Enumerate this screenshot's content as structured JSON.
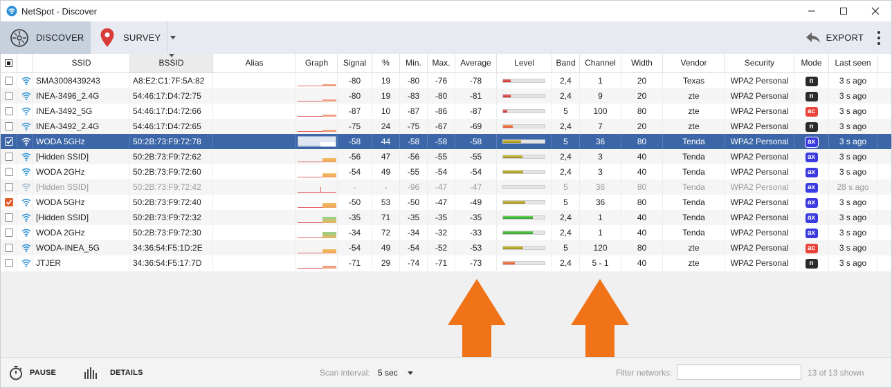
{
  "window": {
    "title": "NetSpot - Discover"
  },
  "toolbar": {
    "discover_label": "DISCOVER",
    "survey_label": "SURVEY",
    "export_label": "EXPORT"
  },
  "columns": [
    "SSID",
    "BSSID",
    "Alias",
    "Graph",
    "Signal",
    "%",
    "Min.",
    "Max.",
    "Average",
    "Level",
    "Band",
    "Channel",
    "Width",
    "Vendor",
    "Security",
    "Mode",
    "Last seen"
  ],
  "rows": [
    {
      "checked": false,
      "ssid": "SMA3008439243",
      "bssid": "A8:E2:C1:7F:5A:82",
      "alias": "",
      "signal": "-80",
      "pct": "19",
      "min": "-80",
      "max": "-76",
      "avg": "-78",
      "level": 0.19,
      "band": "2,4",
      "channel": "1",
      "width": "20",
      "vendor": "Texas",
      "security": "WPA2 Personal",
      "mode": "n",
      "last_seen": "3 s ago",
      "state": "normal"
    },
    {
      "checked": false,
      "ssid": "INEA-3496_2.4G",
      "bssid": "54:46:17:D4:72:75",
      "alias": "",
      "signal": "-80",
      "pct": "19",
      "min": "-83",
      "max": "-80",
      "avg": "-81",
      "level": 0.19,
      "band": "2,4",
      "channel": "9",
      "width": "20",
      "vendor": "zte",
      "security": "WPA2 Personal",
      "mode": "n",
      "last_seen": "3 s ago",
      "state": "normal"
    },
    {
      "checked": false,
      "ssid": "INEA-3492_5G",
      "bssid": "54:46:17:D4:72:66",
      "alias": "",
      "signal": "-87",
      "pct": "10",
      "min": "-87",
      "max": "-86",
      "avg": "-87",
      "level": 0.1,
      "band": "5",
      "channel": "100",
      "width": "80",
      "vendor": "zte",
      "security": "WPA2 Personal",
      "mode": "ac",
      "last_seen": "3 s ago",
      "state": "normal"
    },
    {
      "checked": false,
      "ssid": "INEA-3492_2.4G",
      "bssid": "54:46:17:D4:72:65",
      "alias": "",
      "signal": "-75",
      "pct": "24",
      "min": "-75",
      "max": "-67",
      "avg": "-69",
      "level": 0.24,
      "band": "2,4",
      "channel": "7",
      "width": "20",
      "vendor": "zte",
      "security": "WPA2 Personal",
      "mode": "n",
      "last_seen": "3 s ago",
      "state": "normal"
    },
    {
      "checked": true,
      "ssid": "WODA 5GHz",
      "bssid": "50:2B:73:F9:72:78",
      "alias": "",
      "signal": "-58",
      "pct": "44",
      "min": "-58",
      "max": "-58",
      "avg": "-58",
      "level": 0.44,
      "band": "5",
      "channel": "36",
      "width": "80",
      "vendor": "Tenda",
      "security": "WPA2 Personal",
      "mode": "ax",
      "last_seen": "3 s ago",
      "state": "selected"
    },
    {
      "checked": false,
      "ssid": "[Hidden SSID]",
      "bssid": "50:2B:73:F9:72:62",
      "alias": "",
      "signal": "-56",
      "pct": "47",
      "min": "-56",
      "max": "-55",
      "avg": "-55",
      "level": 0.47,
      "band": "2,4",
      "channel": "3",
      "width": "40",
      "vendor": "Tenda",
      "security": "WPA2 Personal",
      "mode": "ax",
      "last_seen": "3 s ago",
      "state": "normal"
    },
    {
      "checked": false,
      "ssid": "WODA 2GHz",
      "bssid": "50:2B:73:F9:72:60",
      "alias": "",
      "signal": "-54",
      "pct": "49",
      "min": "-55",
      "max": "-54",
      "avg": "-54",
      "level": 0.49,
      "band": "2,4",
      "channel": "3",
      "width": "40",
      "vendor": "Tenda",
      "security": "WPA2 Personal",
      "mode": "ax",
      "last_seen": "3 s ago",
      "state": "normal"
    },
    {
      "checked": false,
      "ssid": "[Hidden SSID]",
      "bssid": "50:2B:73:F9:72:42",
      "alias": "",
      "signal": "-",
      "pct": "-",
      "min": "-96",
      "max": "-47",
      "avg": "-47",
      "level": 0,
      "band": "5",
      "channel": "36",
      "width": "80",
      "vendor": "Tenda",
      "security": "WPA2 Personal",
      "mode": "ax",
      "last_seen": "28 s ago",
      "state": "stale"
    },
    {
      "checked": true,
      "ssid": "WODA 5GHz",
      "bssid": "50:2B:73:F9:72:40",
      "alias": "",
      "signal": "-50",
      "pct": "53",
      "min": "-50",
      "max": "-47",
      "avg": "-49",
      "level": 0.53,
      "band": "5",
      "channel": "36",
      "width": "80",
      "vendor": "Tenda",
      "security": "WPA2 Personal",
      "mode": "ax",
      "last_seen": "3 s ago",
      "state": "normal"
    },
    {
      "checked": false,
      "ssid": "[Hidden SSID]",
      "bssid": "50:2B:73:F9:72:32",
      "alias": "",
      "signal": "-35",
      "pct": "71",
      "min": "-35",
      "max": "-35",
      "avg": "-35",
      "level": 0.71,
      "band": "2,4",
      "channel": "1",
      "width": "40",
      "vendor": "Tenda",
      "security": "WPA2 Personal",
      "mode": "ax",
      "last_seen": "3 s ago",
      "state": "normal"
    },
    {
      "checked": false,
      "ssid": "WODA 2GHz",
      "bssid": "50:2B:73:F9:72:30",
      "alias": "",
      "signal": "-34",
      "pct": "72",
      "min": "-34",
      "max": "-32",
      "avg": "-33",
      "level": 0.72,
      "band": "2,4",
      "channel": "1",
      "width": "40",
      "vendor": "Tenda",
      "security": "WPA2 Personal",
      "mode": "ax",
      "last_seen": "3 s ago",
      "state": "normal"
    },
    {
      "checked": false,
      "ssid": "WODA-INEA_5G",
      "bssid": "34:36:54:F5:1D:2E",
      "alias": "",
      "signal": "-54",
      "pct": "49",
      "min": "-54",
      "max": "-52",
      "avg": "-53",
      "level": 0.49,
      "band": "5",
      "channel": "120",
      "width": "80",
      "vendor": "zte",
      "security": "WPA2 Personal",
      "mode": "ac",
      "last_seen": "3 s ago",
      "state": "normal"
    },
    {
      "checked": false,
      "ssid": "JTJER",
      "bssid": "34:36:54:F5:17:7D",
      "alias": "",
      "signal": "-71",
      "pct": "29",
      "min": "-74",
      "max": "-71",
      "avg": "-73",
      "level": 0.29,
      "band": "2,4",
      "channel": "5 - 1",
      "width": "40",
      "vendor": "zte",
      "security": "WPA2 Personal",
      "mode": "n",
      "last_seen": "3 s ago",
      "state": "normal"
    }
  ],
  "footer": {
    "pause_label": "PAUSE",
    "details_label": "DETAILS",
    "scan_interval_label": "Scan interval:",
    "scan_interval_value": "5 sec",
    "filter_label": "Filter networks:",
    "filter_value": "",
    "shown_count": "13 of 13 shown"
  },
  "colors": {
    "accent_selected": "#3c66a8",
    "annotation_arrow": "#f07318"
  }
}
